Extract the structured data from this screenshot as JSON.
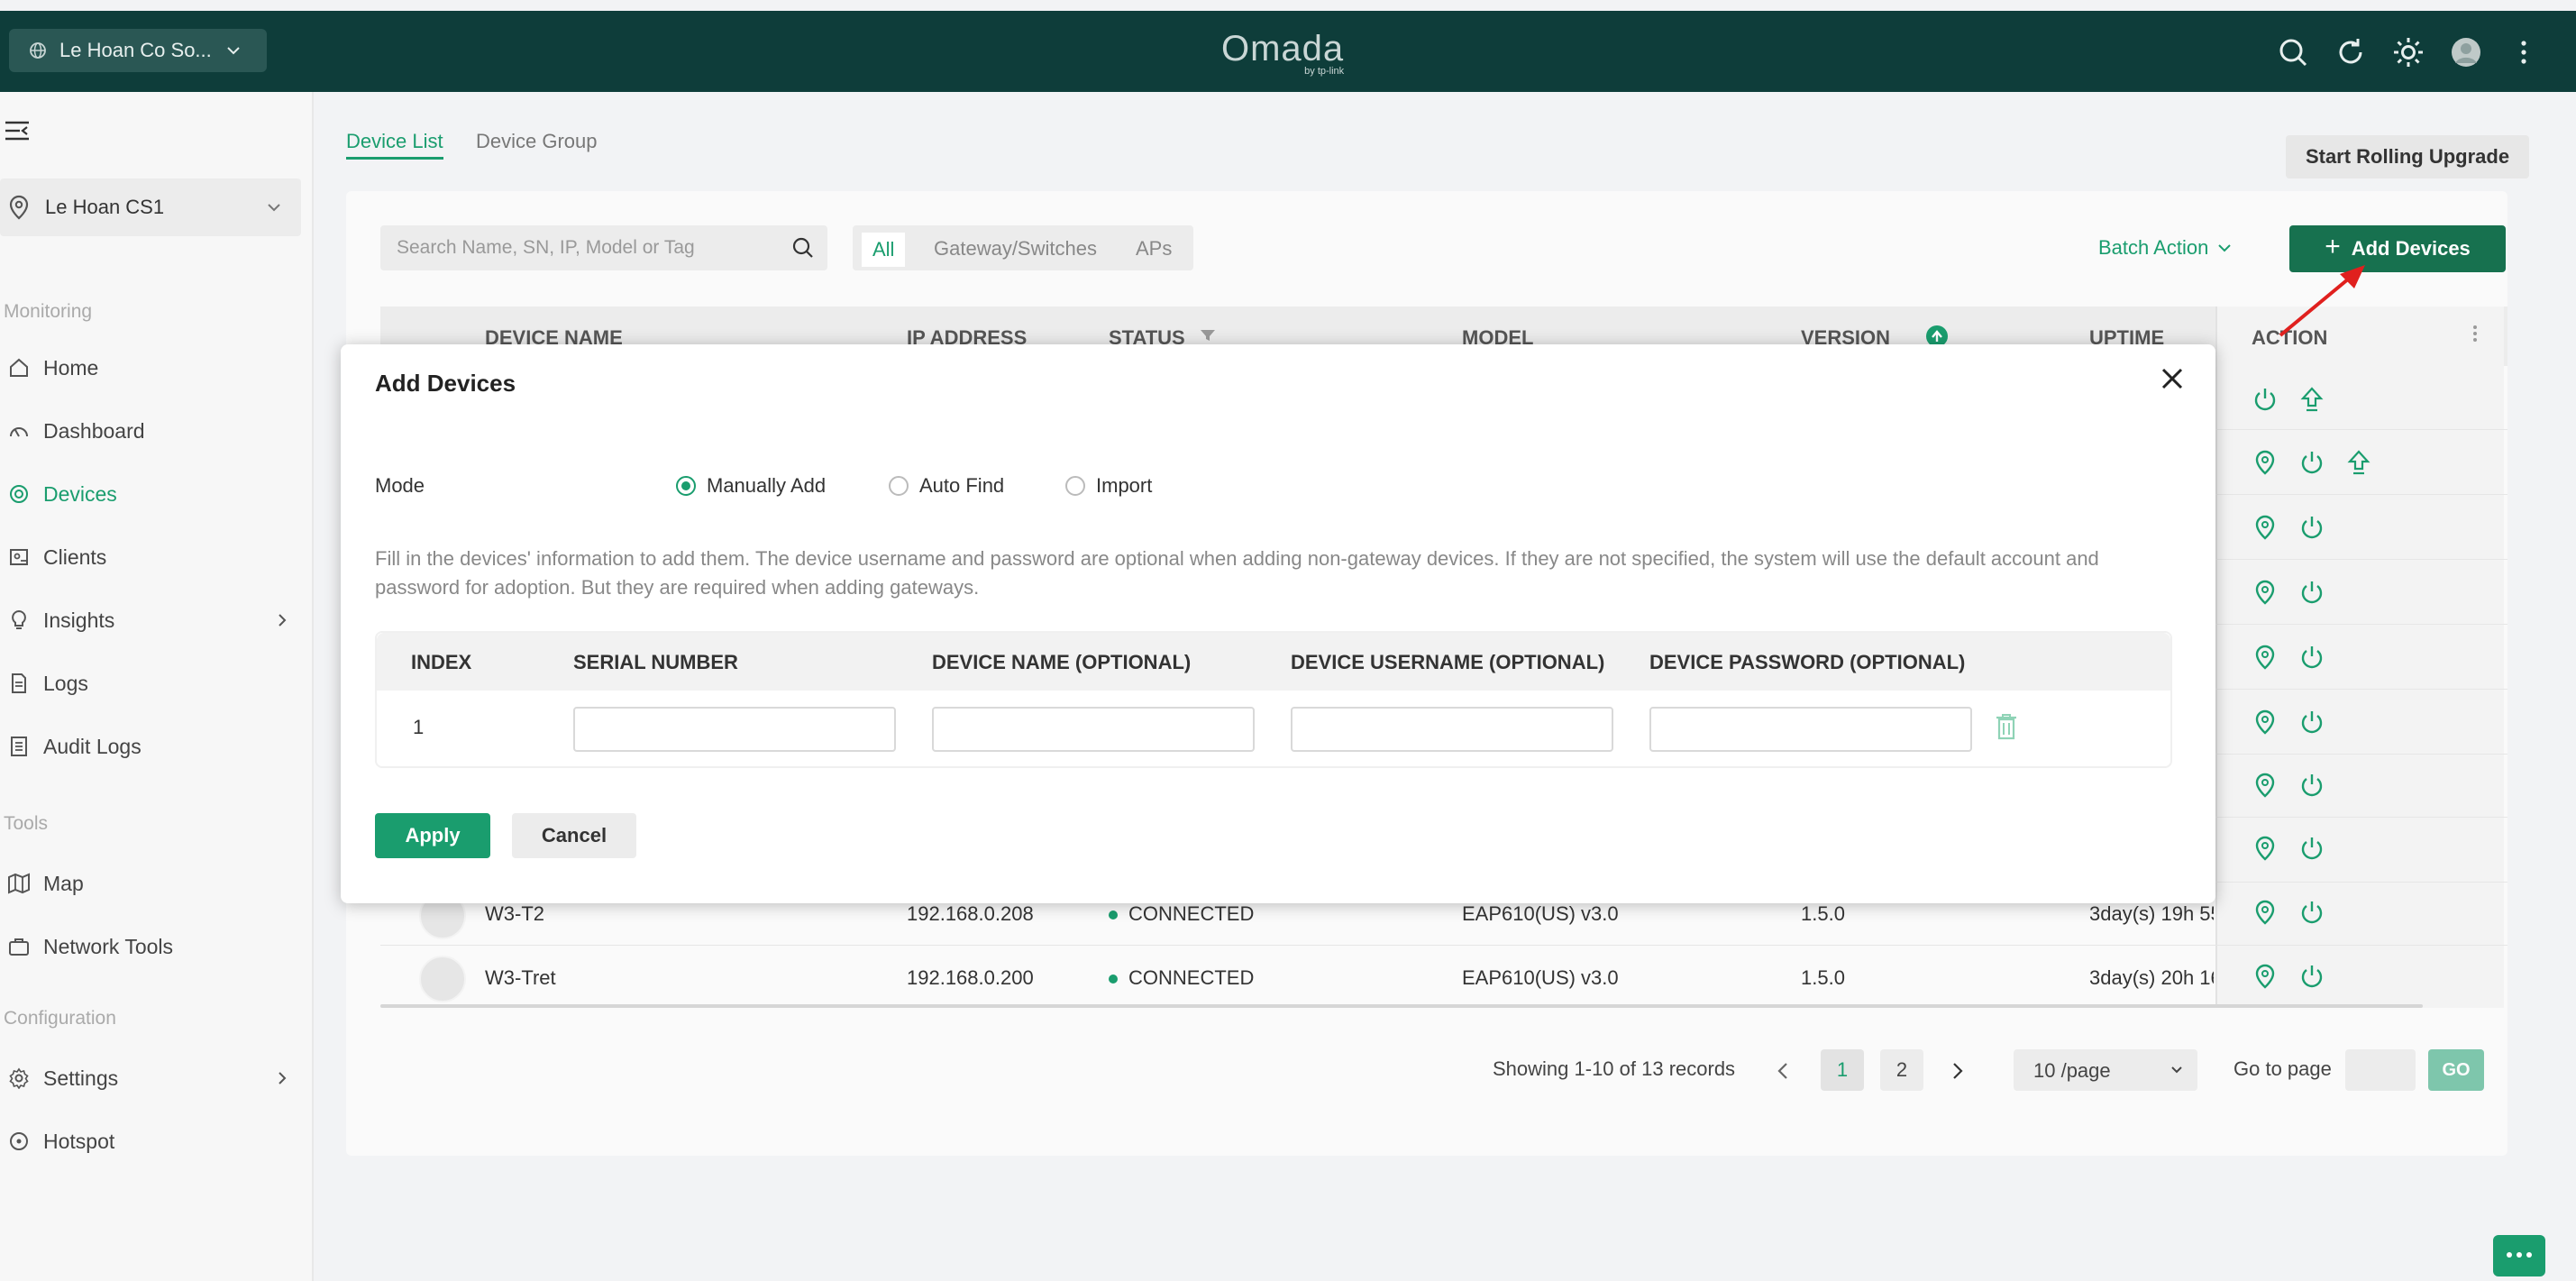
{
  "topbar": {
    "site_selector": "Le Hoan Co So...",
    "brand": "Omada",
    "brand_sub": "by tp-link"
  },
  "sidebar": {
    "site": "Le Hoan CS1",
    "sections": {
      "monitoring": "Monitoring",
      "tools": "Tools",
      "configuration": "Configuration"
    },
    "items": {
      "home": "Home",
      "dashboard": "Dashboard",
      "devices": "Devices",
      "clients": "Clients",
      "insights": "Insights",
      "logs": "Logs",
      "audit_logs": "Audit Logs",
      "map": "Map",
      "network_tools": "Network Tools",
      "settings": "Settings",
      "hotspot": "Hotspot"
    }
  },
  "main": {
    "tabs": {
      "device_list": "Device List",
      "device_group": "Device Group"
    },
    "rolling_upgrade": "Start Rolling Upgrade",
    "search_placeholder": "Search Name, SN, IP, Model or Tag",
    "filters": {
      "all": "All",
      "gateway_switches": "Gateway/Switches",
      "aps": "APs"
    },
    "batch_action": "Batch Action",
    "add_devices": "Add Devices",
    "columns": {
      "device_name": "DEVICE NAME",
      "ip_address": "IP ADDRESS",
      "status": "STATUS",
      "model": "MODEL",
      "version": "VERSION",
      "uptime": "UPTIME",
      "action": "ACTION"
    },
    "rows": [
      {
        "name": "W3-T2",
        "ip": "192.168.0.208",
        "status": "CONNECTED",
        "model": "EAP610(US) v3.0",
        "version": "1.5.0",
        "uptime": "3day(s) 19h 55"
      },
      {
        "name": "W3-Tret",
        "ip": "192.168.0.200",
        "status": "CONNECTED",
        "model": "EAP610(US) v3.0",
        "version": "1.5.0",
        "uptime": "3day(s) 20h 16"
      }
    ],
    "pagination": {
      "summary": "Showing 1-10 of 13 records",
      "page1": "1",
      "page2": "2",
      "per_page": "10 /page",
      "goto_label": "Go to page",
      "go": "GO"
    }
  },
  "modal": {
    "title": "Add Devices",
    "mode_label": "Mode",
    "modes": {
      "manual": "Manually Add",
      "auto": "Auto Find",
      "import": "Import"
    },
    "selected_mode": "Manually Add",
    "description": "Fill in the devices' information to add them. The device username and password are optional when adding non-gateway devices. If they are not specified, the system will use the default account and password for adoption. But they are required when adding gateways.",
    "columns": {
      "index": "INDEX",
      "serial": "SERIAL NUMBER",
      "device_name": "DEVICE NAME (OPTIONAL)",
      "username": "DEVICE USERNAME (OPTIONAL)",
      "password": "DEVICE PASSWORD (OPTIONAL)"
    },
    "row_index": "1",
    "apply": "Apply",
    "cancel": "Cancel"
  },
  "colors": {
    "topbar": "#0e3d3a",
    "accent": "#1a9d6e",
    "add_button": "#17714f",
    "annotation_arrow": "#e0201e"
  },
  "icons": [
    "globe-icon",
    "search-icon",
    "refresh-icon",
    "theme-icon",
    "avatar",
    "more-icon",
    "sidebar-collapse-icon",
    "location-icon",
    "home-icon",
    "dashboard-icon",
    "devices-icon",
    "clients-icon",
    "insights-icon",
    "logs-icon",
    "audit-logs-icon",
    "map-icon",
    "network-tools-icon",
    "settings-icon",
    "hotspot-icon",
    "close-icon",
    "trash-icon",
    "power-icon",
    "upgrade-icon",
    "chat-icon"
  ]
}
